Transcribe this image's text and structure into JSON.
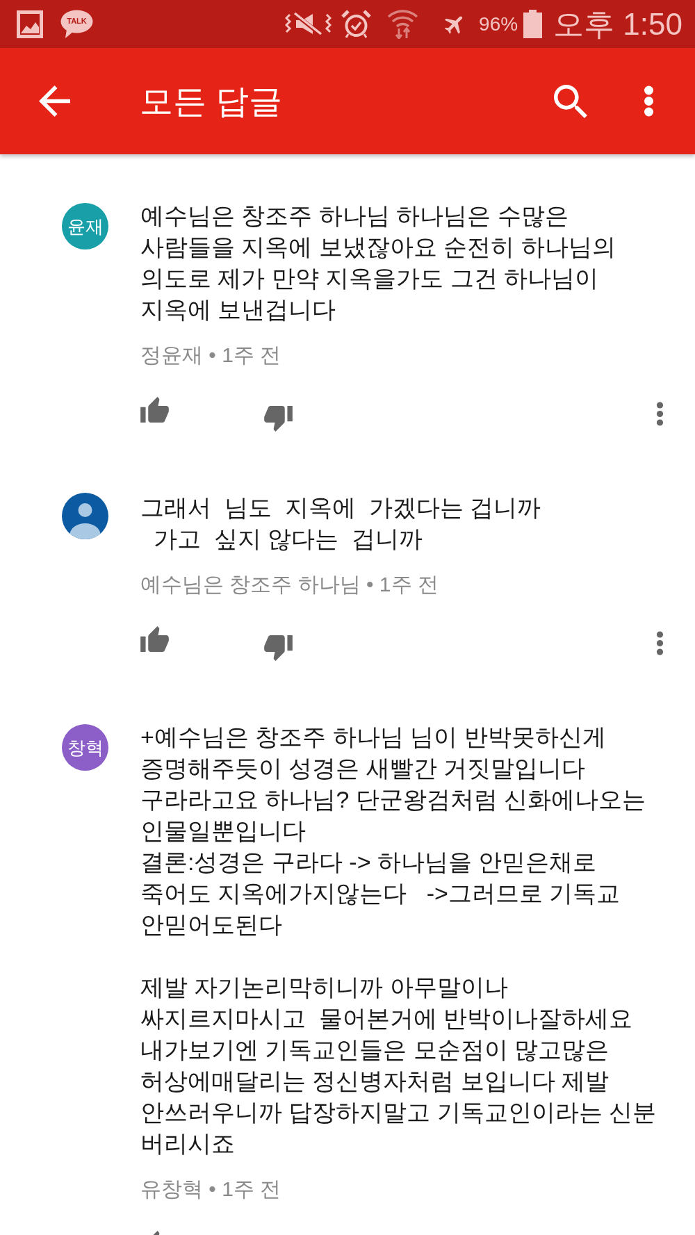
{
  "status_bar": {
    "app_label": "TALK",
    "battery": "96%",
    "time": "오후 1:50"
  },
  "app_bar": {
    "title": "모든 답글"
  },
  "comments": [
    {
      "avatar": {
        "kind": "initials",
        "text": "윤재",
        "color": "#189fa8"
      },
      "text": "예수님은 창조주 하나님 하나님은 수많은\n사람들을 지옥에 보냈잖아요 순전히 하나님의\n의도로 제가 만약 지옥을가도 그건 하나님이\n지옥에 보낸겁니다",
      "byline": "정윤재 • 1주 전"
    },
    {
      "avatar": {
        "kind": "silhouette",
        "color": "#0b5aa2"
      },
      "text": "그래서  님도  지옥에  가겠다는 겁니까\n  가고  싶지 않다는  겁니까",
      "byline": "예수님은 창조주 하나님 • 1주 전"
    },
    {
      "avatar": {
        "kind": "initials",
        "text": "창혁",
        "color": "#8b5ec8"
      },
      "text": "+예수님은 창조주 하나님 님이 반박못하신게\n증명해주듯이 성경은 새빨간 거짓말입니다\n구라라고요 하나님? 단군왕검처럼 신화에나오는\n인물일뿐입니다\n결론:성경은 구라다 -> 하나님을 안믿은채로\n죽어도 지옥에가지않는다   ->그러므로 기독교\n안믿어도된다\n\n제발 자기논리막히니까 아무말이나\n싸지르지마시고  물어본거에 반박이나잘하세요\n내가보기엔 기독교인들은 모순점이 많고많은\n허상에매달리는 정신병자처럼 보입니다 제발\n안쓰러우니까 답장하지말고 기독교인이라는 신분\n버리시죠",
      "byline": "유창혁 • 1주 전"
    }
  ]
}
